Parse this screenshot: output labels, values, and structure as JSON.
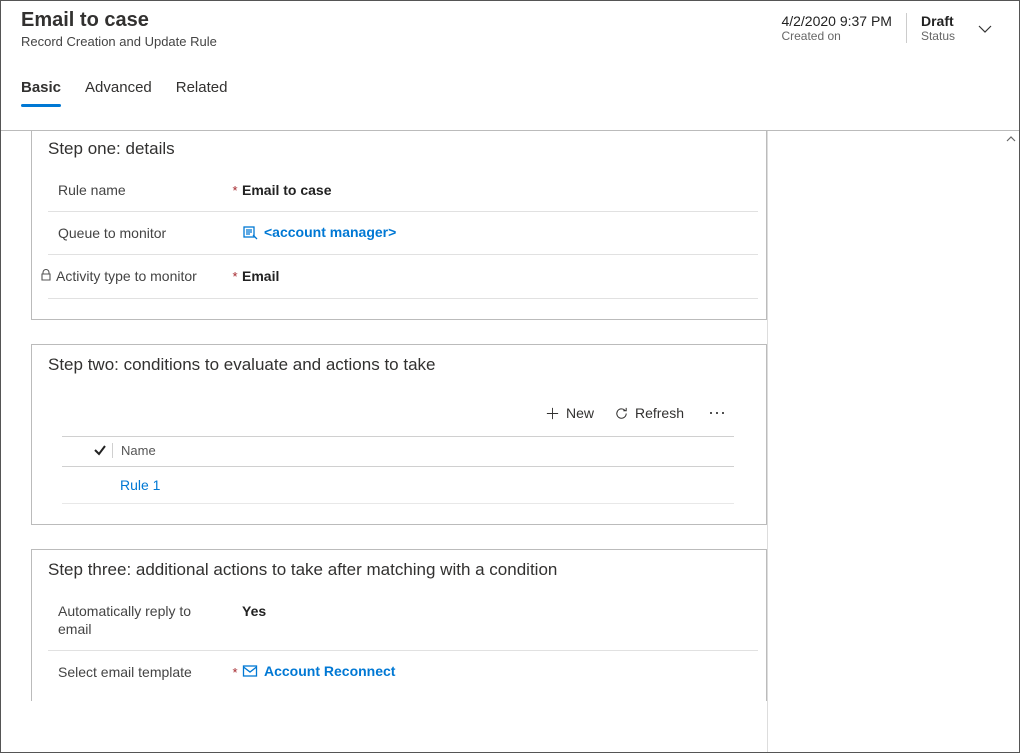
{
  "header": {
    "title": "Email to case",
    "subtitle": "Record Creation and Update Rule",
    "created_value": "4/2/2020 9:37 PM",
    "created_label": "Created on",
    "status_value": "Draft",
    "status_label": "Status"
  },
  "tabs": {
    "basic": "Basic",
    "advanced": "Advanced",
    "related": "Related"
  },
  "step1": {
    "title": "Step one: details",
    "rule_name_label": "Rule name",
    "rule_name_value": "Email to case",
    "queue_label": "Queue to monitor",
    "queue_value": "<account manager>",
    "activity_label": "Activity type to monitor",
    "activity_value": "Email"
  },
  "step2": {
    "title": "Step two: conditions to evaluate and actions to take",
    "new_label": "New",
    "refresh_label": "Refresh",
    "col_name": "Name",
    "row1": "Rule 1"
  },
  "step3": {
    "title": "Step three: additional actions to take after matching with a condition",
    "auto_reply_label": "Automatically reply to email",
    "auto_reply_value": "Yes",
    "template_label": "Select email template",
    "template_value": "Account Reconnect"
  }
}
